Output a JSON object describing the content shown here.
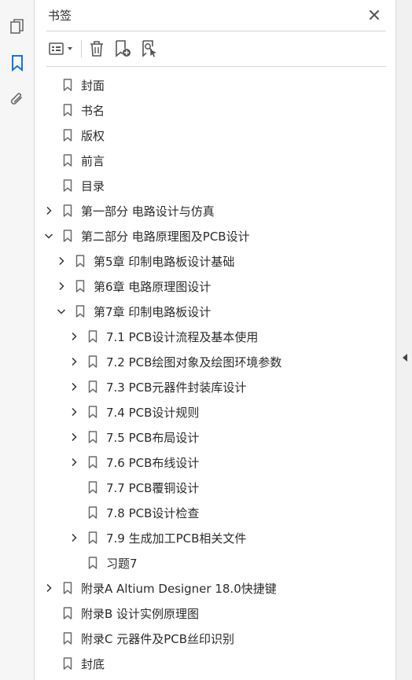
{
  "panel": {
    "title": "书签"
  },
  "colors": {
    "accent": "#1473e6",
    "icon": "#6b6b6b",
    "text": "#2b2b2b"
  },
  "rail_icons": [
    "pages-icon",
    "bookmarks-icon",
    "attachments-icon"
  ],
  "bookmarks": [
    {
      "label": "封面",
      "level": 0,
      "expander": "none"
    },
    {
      "label": "书名",
      "level": 0,
      "expander": "none"
    },
    {
      "label": "版权",
      "level": 0,
      "expander": "none"
    },
    {
      "label": "前言",
      "level": 0,
      "expander": "none"
    },
    {
      "label": "目录",
      "level": 0,
      "expander": "none"
    },
    {
      "label": "第一部分  电路设计与仿真",
      "level": 0,
      "expander": "collapsed"
    },
    {
      "label": "第二部分  电路原理图及PCB设计",
      "level": 0,
      "expander": "expanded"
    },
    {
      "label": "第5章  印制电路板设计基础",
      "level": 1,
      "expander": "collapsed"
    },
    {
      "label": "第6章  电路原理图设计",
      "level": 1,
      "expander": "collapsed"
    },
    {
      "label": "第7章  印制电路板设计",
      "level": 1,
      "expander": "expanded"
    },
    {
      "label": "7.1  PCB设计流程及基本使用",
      "level": 2,
      "expander": "collapsed"
    },
    {
      "label": "7.2  PCB绘图对象及绘图环境参数",
      "level": 2,
      "expander": "collapsed"
    },
    {
      "label": "7.3  PCB元器件封装库设计",
      "level": 2,
      "expander": "collapsed"
    },
    {
      "label": "7.4  PCB设计规则",
      "level": 2,
      "expander": "collapsed"
    },
    {
      "label": "7.5  PCB布局设计",
      "level": 2,
      "expander": "collapsed"
    },
    {
      "label": "7.6  PCB布线设计",
      "level": 2,
      "expander": "collapsed"
    },
    {
      "label": "7.7  PCB覆铜设计",
      "level": 2,
      "expander": "none"
    },
    {
      "label": "7.8  PCB设计检查",
      "level": 2,
      "expander": "none"
    },
    {
      "label": "7.9  生成加工PCB相关文件",
      "level": 2,
      "expander": "collapsed"
    },
    {
      "label": "习题7",
      "level": 2,
      "expander": "none"
    },
    {
      "label": "附录A  Altium Designer 18.0快捷键",
      "level": 0,
      "expander": "collapsed"
    },
    {
      "label": "附录B  设计实例原理图",
      "level": 0,
      "expander": "none"
    },
    {
      "label": "附录C  元器件及PCB丝印识别",
      "level": 0,
      "expander": "none"
    },
    {
      "label": "封底",
      "level": 0,
      "expander": "none"
    }
  ]
}
